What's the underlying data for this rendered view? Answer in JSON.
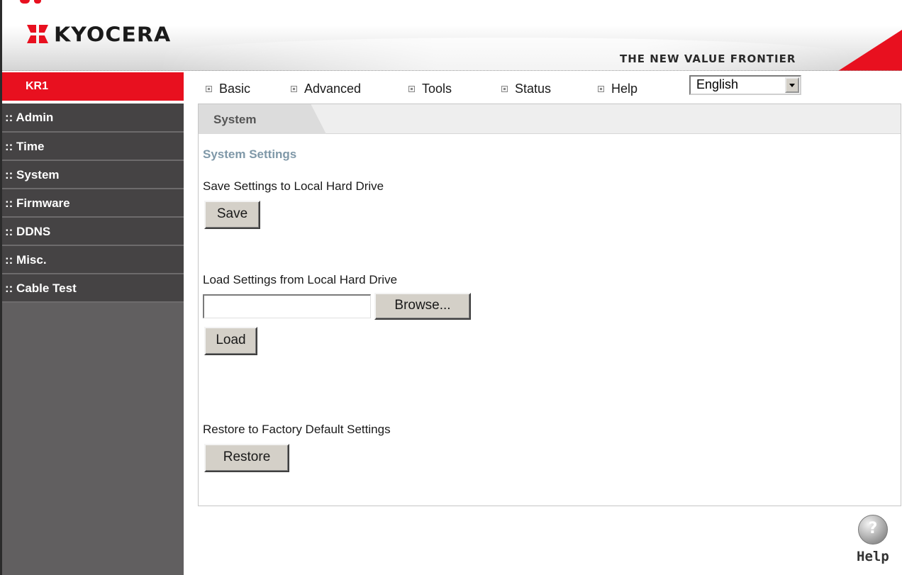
{
  "colors": {
    "brand_red": "#e8101f",
    "sidebar_dark": "#454344",
    "sidebar_bg": "#615f60",
    "section_title": "#7f98a8"
  },
  "header": {
    "logo_text": "KYOCERA",
    "tagline": "THE NEW VALUE FRONTIER"
  },
  "device": {
    "name": "KR1"
  },
  "nav": {
    "items": [
      {
        "label": "Basic"
      },
      {
        "label": "Advanced"
      },
      {
        "label": "Tools"
      },
      {
        "label": "Status"
      },
      {
        "label": "Help"
      }
    ],
    "language": {
      "selected": "English"
    }
  },
  "sidebar": {
    "items": [
      {
        "label": ":: Admin"
      },
      {
        "label": ":: Time"
      },
      {
        "label": ":: System"
      },
      {
        "label": ":: Firmware"
      },
      {
        "label": ":: DDNS"
      },
      {
        "label": ":: Misc."
      },
      {
        "label": ":: Cable Test"
      }
    ]
  },
  "main": {
    "tab": "System",
    "section_title": "System Settings",
    "save_label": "Save Settings to Local Hard Drive",
    "save_button": "Save",
    "load_label": "Load Settings from Local Hard Drive",
    "browse_button": "Browse...",
    "load_button": "Load",
    "restore_label": "Restore to Factory Default Settings",
    "restore_button": "Restore"
  },
  "help": {
    "icon_glyph": "?",
    "label": "Help"
  }
}
